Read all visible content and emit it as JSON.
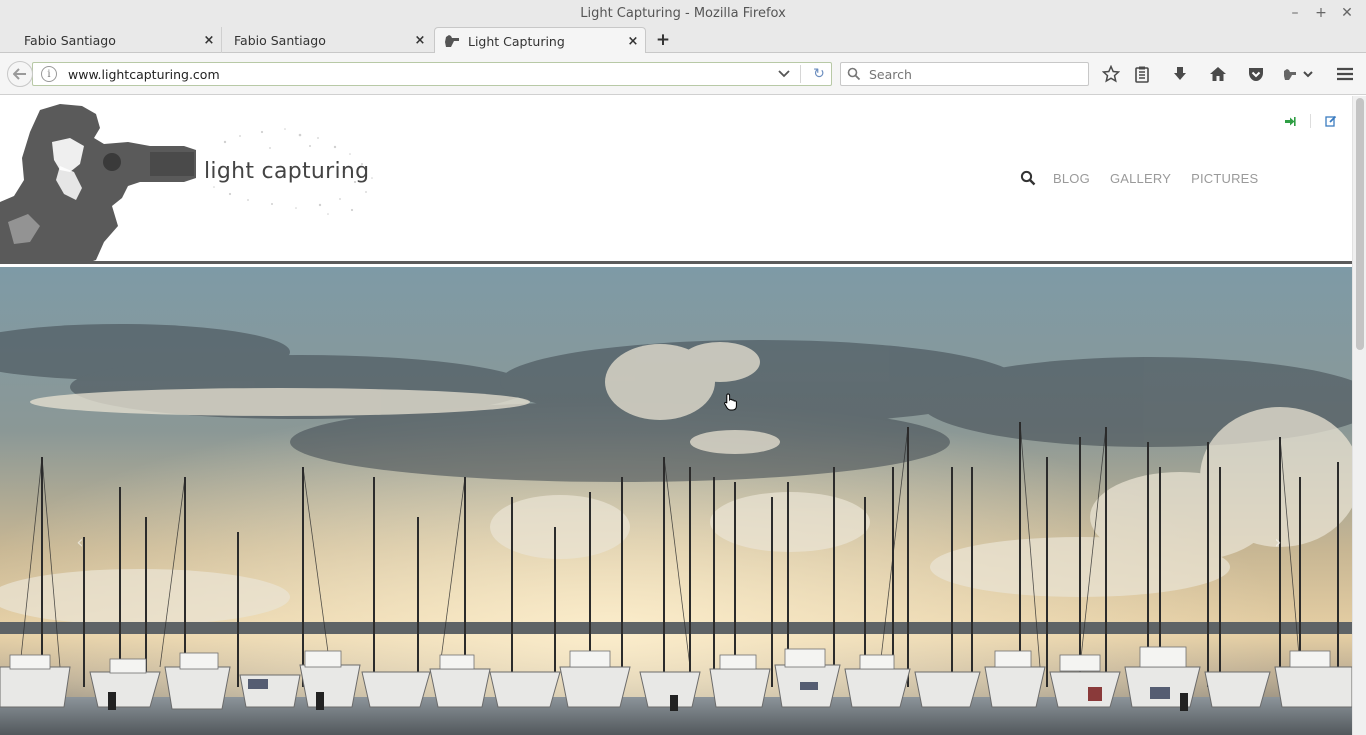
{
  "window": {
    "title": "Light Capturing - Mozilla Firefox",
    "controls": {
      "minimize": "–",
      "maximize": "+",
      "close": "✕"
    }
  },
  "tabs": [
    {
      "label": "Fabio Santiago",
      "close": "×"
    },
    {
      "label": "Fabio Santiago",
      "close": "×"
    },
    {
      "label": "Light Capturing",
      "close": "×"
    }
  ],
  "new_tab": "+",
  "navbar": {
    "back": "←",
    "info": "i",
    "url": "www.lightcapturing.com",
    "dropdown": "⌄",
    "reload": "↻",
    "search_placeholder": "Search"
  },
  "toolbar": {
    "bookmark_star": "☆",
    "reader": "▤",
    "download": "⬇",
    "home": "⌂",
    "pocket": "◈",
    "menu": "≡"
  },
  "site": {
    "logo_text": "light capturing",
    "nav": [
      "BLOG",
      "GALLERY",
      "PICTURES"
    ],
    "login_icon": "➜",
    "register_icon": "✎",
    "prev_arrow": "‹",
    "next_arrow": "›"
  },
  "colors": {
    "accent_green": "#2f9e44",
    "accent_blue": "#3b7cc0",
    "header_rule": "#5b5b5b",
    "nav_text": "#9a9a9a"
  },
  "icons": [
    "search-icon",
    "login-icon",
    "edit-icon",
    "home-icon",
    "download-icon",
    "bookmark-star-icon",
    "reading-list-icon",
    "pocket-icon",
    "menu-icon",
    "info-icon",
    "reload-icon",
    "back-icon"
  ]
}
